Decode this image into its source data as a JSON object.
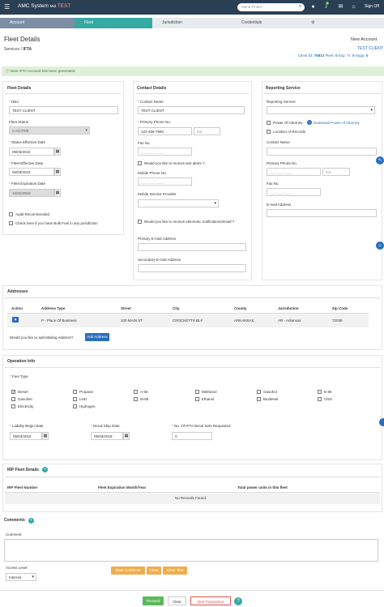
{
  "app": {
    "title": "AMC System",
    "env_prefix": "Mid",
    "env": "TEST",
    "menu_icon": "hamburger-icon",
    "search_placeholder": "Menu Finder...",
    "notif_count": "0",
    "signoff": "Sign Off"
  },
  "steps": [
    {
      "label": "Account"
    },
    {
      "label": "Fleet"
    },
    {
      "label": "Jurisdiction"
    },
    {
      "label": "Credentials"
    }
  ],
  "page": {
    "title": "Fleet Details",
    "breadcrumb_home": "Services",
    "breadcrumb_sep": "/",
    "breadcrumb_current": "IFTA"
  },
  "header_right": {
    "new_account": "New Account",
    "client_name": "TEST CLIENT",
    "client_id_label": "Client ID:",
    "client_id": "75813",
    "fleet_label": "Fleet:",
    "fleet": "0",
    "exp_label": "Exp. Yr:",
    "exp": "0",
    "supp_label": "Supp:",
    "supp": "0"
  },
  "alert": {
    "text": "New IFTA Account has been generated."
  },
  "fleet_details": {
    "title": "Fleet Details",
    "dba_label": "DBA",
    "dba_value": "TEST CLIENT",
    "status_label": "Fleet Status",
    "status_value": "A-ACTIVE",
    "status_eff_label": "Status Effective Date",
    "status_eff_value": "05/03/2018",
    "fleet_eff_label": "Fleet Effective Date",
    "fleet_eff_value": "05/03/2018",
    "fleet_exp_label": "Fleet Expiration Date",
    "fleet_exp_value": "12/31/2018",
    "audit_label": "Audit Recommended",
    "bulk_label": "Check here if you have Bulk Fuel in any jurisdiction"
  },
  "contact": {
    "title": "Contact Details",
    "name_label": "Contact Name",
    "name_value": "TEST CLIENT",
    "phone_label": "Primary Phone No.",
    "phone_value": "123-456-7890",
    "ext_placeholder": "Ext.",
    "fax_label": "Fax No.",
    "phone_mask": "___-___-____",
    "text_alerts_label": "Would you like to receive text alerts ?",
    "mobile_label": "Mobile Phone No.",
    "provider_label": "Mobile Service Provider",
    "email_notif_label": "Would you like to receive electronic notifications/email ?",
    "primary_email_label": "Primary E-mail Address",
    "secondary_email_label": "Secondary E-mail Address"
  },
  "reporting": {
    "title": "Reporting Service",
    "service_label": "Reporting Service",
    "poa_label": "Power Of Attorney",
    "poa_link": "Download Power of Attorney",
    "location_label": "Location of Records",
    "contact_name_label": "Contact Name",
    "phone_label": "Primary Phone No.",
    "ext_placeholder": "Ext",
    "fax_label": "Fax No.",
    "email_label": "E-mail Address",
    "phone_mask": "___-___-____"
  },
  "addresses": {
    "title": "Addresses",
    "columns": [
      "Action",
      "Address Type",
      "Street",
      "City",
      "County",
      "Jurisdiction",
      "Zip Code"
    ],
    "row": [
      "P - Place Of Business",
      "100 MAIN ST",
      "CROCKETTS BLF",
      "ARKANSAS",
      "AR - Arkansas",
      "72038"
    ],
    "mailing_q": "Would you like to add Mailing Address?",
    "add_btn": "Add Address"
  },
  "operation": {
    "title": "Operation Info",
    "fuel_label": "Fuel Type",
    "fuels": [
      {
        "name": "Diesel",
        "checked": true
      },
      {
        "name": "Propane",
        "checked": false
      },
      {
        "name": "A-55",
        "checked": false
      },
      {
        "name": "Methanol",
        "checked": false
      },
      {
        "name": "Gasohol",
        "checked": false
      },
      {
        "name": "E-85",
        "checked": false
      },
      {
        "name": "Gasoline",
        "checked": false
      },
      {
        "name": "LNG",
        "checked": false
      },
      {
        "name": "M-85",
        "checked": false
      },
      {
        "name": "Ethanol",
        "checked": false
      },
      {
        "name": "Biodiesel",
        "checked": false
      },
      {
        "name": "CNG",
        "checked": false
      },
      {
        "name": "Electricity",
        "checked": false
      },
      {
        "name": "Hydrogen",
        "checked": false
      }
    ],
    "liability_label": "Liability Begin Date",
    "liability_value": "05/03/2018",
    "decal_ship_label": "Decal Ship Date",
    "decal_ship_value": "05/03/2018",
    "decal_sets_label": "No. Of IFTA Decal Sets Requested",
    "decal_sets_value": "0"
  },
  "irp": {
    "title": "IRP Fleet Details",
    "columns": [
      "IRP Fleet Number",
      "Fleet Expiration Month/Year",
      "Total power units in this fleet"
    ],
    "empty": "No Records Found."
  },
  "comments": {
    "title": "Comments",
    "comment_label": "Comment",
    "save_btn": "Save Comment",
    "clear_btn": "Clear",
    "clear_text_btn": "Clear Text",
    "access_label": "Access Level",
    "access_value": "Internal"
  },
  "footer": {
    "proceed": "Proceed",
    "clear": "Clear",
    "quit": "Quit Transaction",
    "help": "?"
  },
  "colors": {
    "topbar": "#2a3f54",
    "active_step": "#36a9a5",
    "link": "#2a6ebb",
    "success_bg": "#dff0d8",
    "proceed": "#5cb85c",
    "quit": "#d9534f",
    "save": "#f0ad4e"
  }
}
